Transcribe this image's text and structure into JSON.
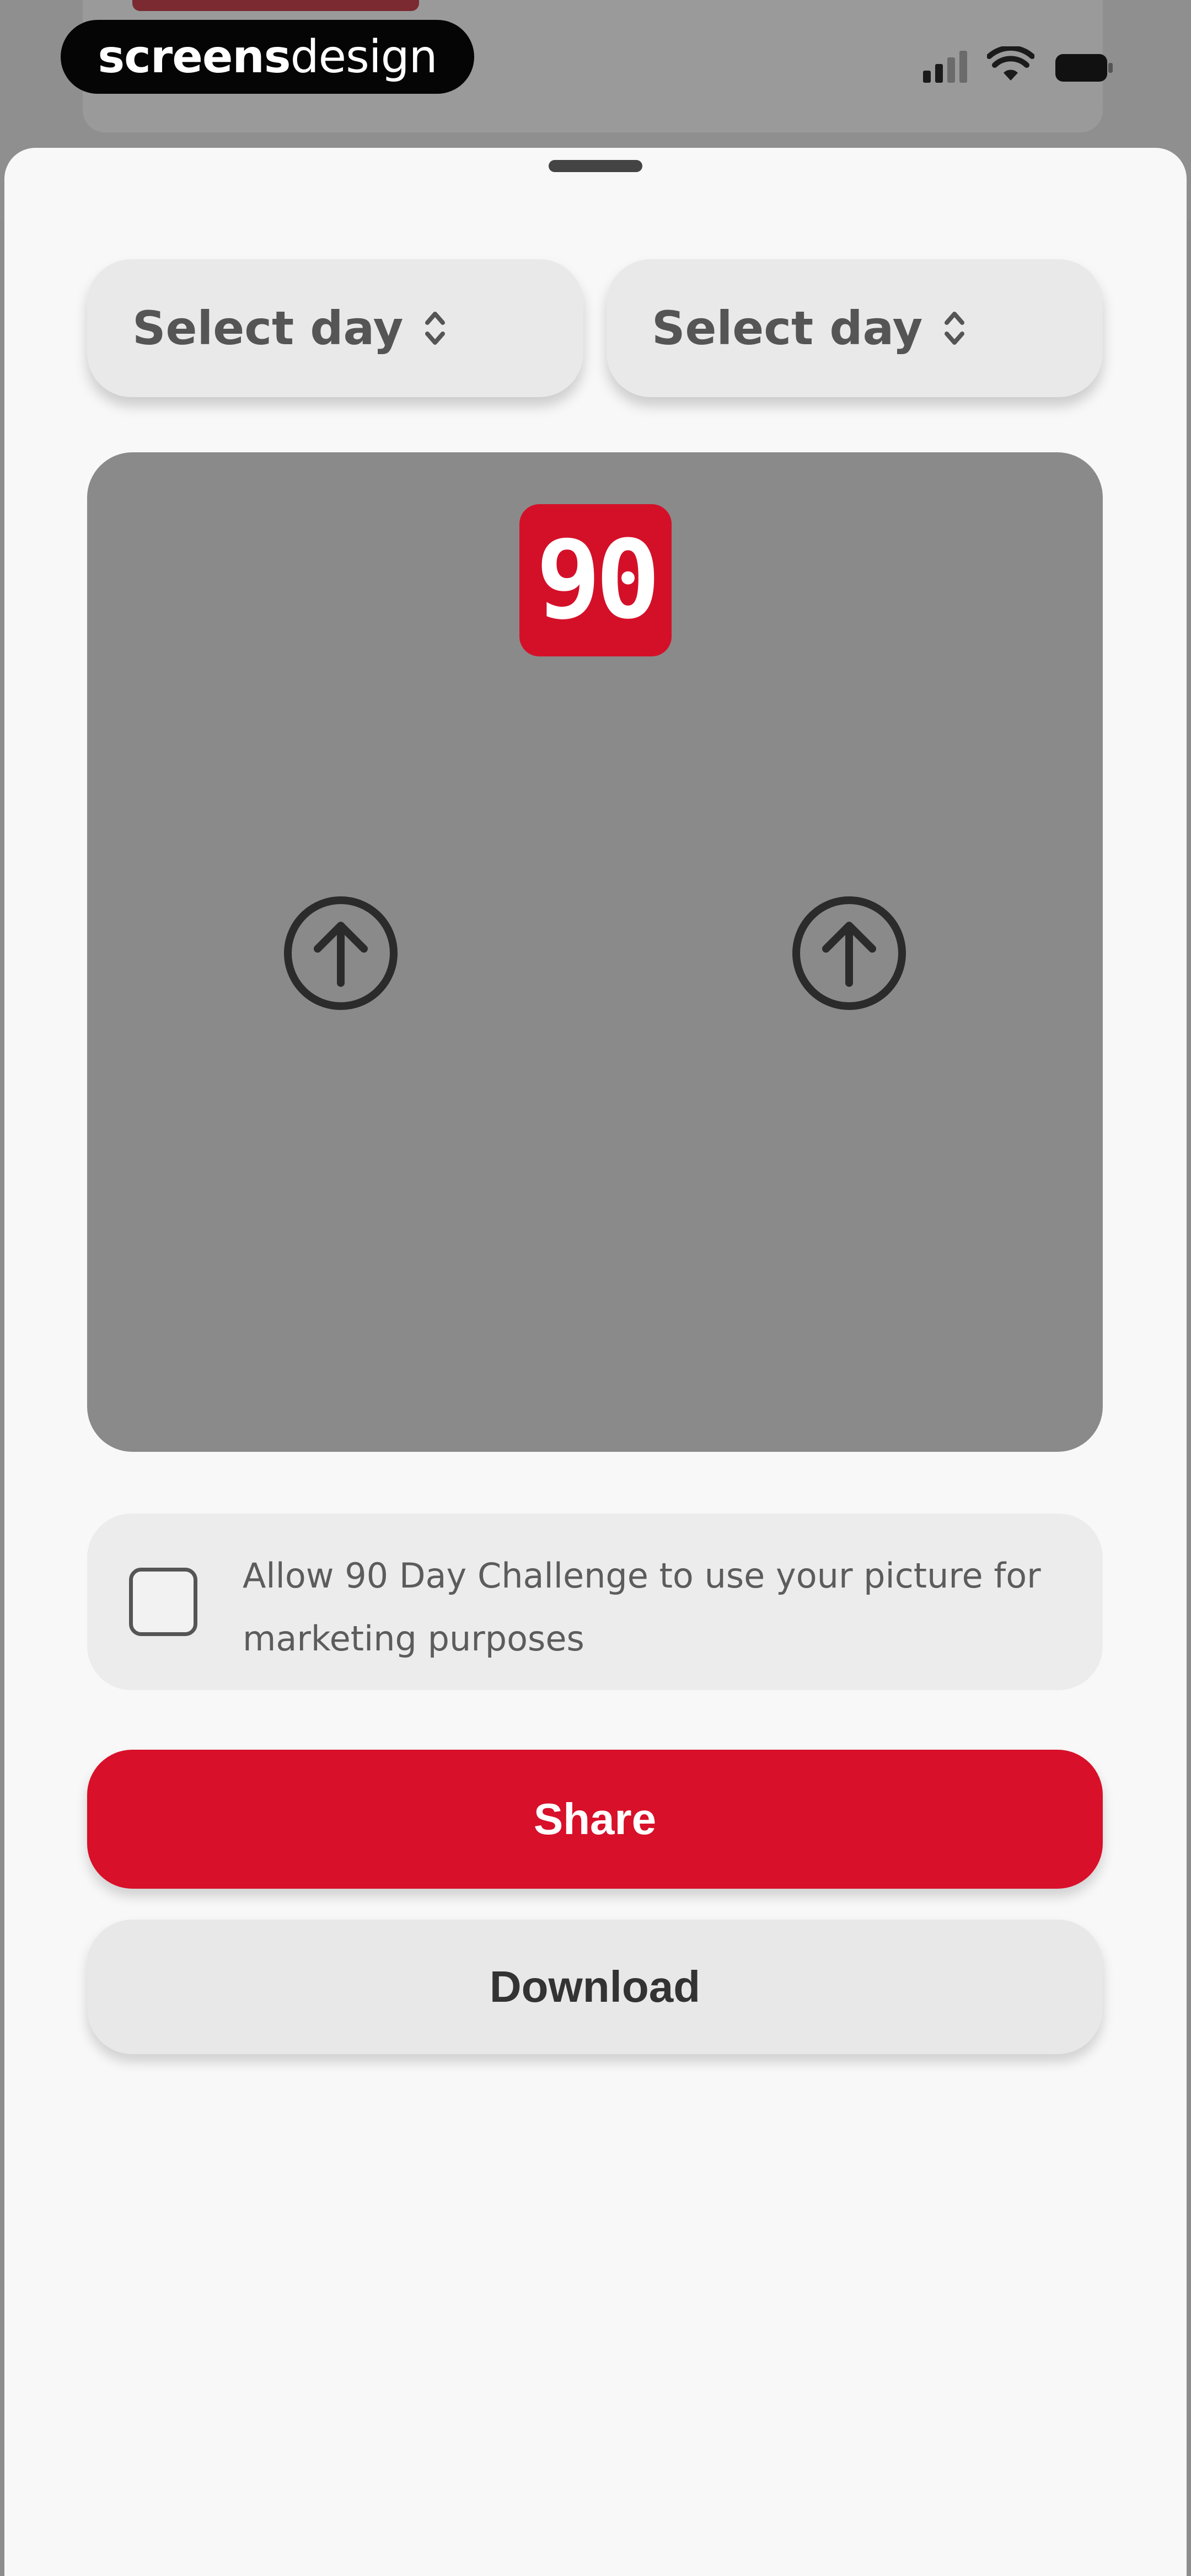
{
  "watermark": {
    "part_bold": "screens",
    "part_light": "design"
  },
  "status_bar": {
    "signal_icon": "cellular-signal-icon",
    "wifi_icon": "wifi-icon",
    "battery_icon": "battery-icon"
  },
  "day_selectors": [
    {
      "label": "Select day",
      "icon": "chevron-up-down-icon"
    },
    {
      "label": "Select day",
      "icon": "chevron-up-down-icon"
    }
  ],
  "preview": {
    "logo_text": "90",
    "upload_icon": "arrow-up-circle-icon"
  },
  "consent": {
    "checked": false,
    "text": "Allow 90 Day Challenge to use your picture for marketing purposes"
  },
  "actions": {
    "share_label": "Share",
    "download_label": "Download"
  },
  "colors": {
    "brand_red": "#d81029",
    "sheet_bg": "#f8f8f8",
    "preview_bg": "#8a8a8a",
    "button_grey": "#e8e8e8"
  }
}
